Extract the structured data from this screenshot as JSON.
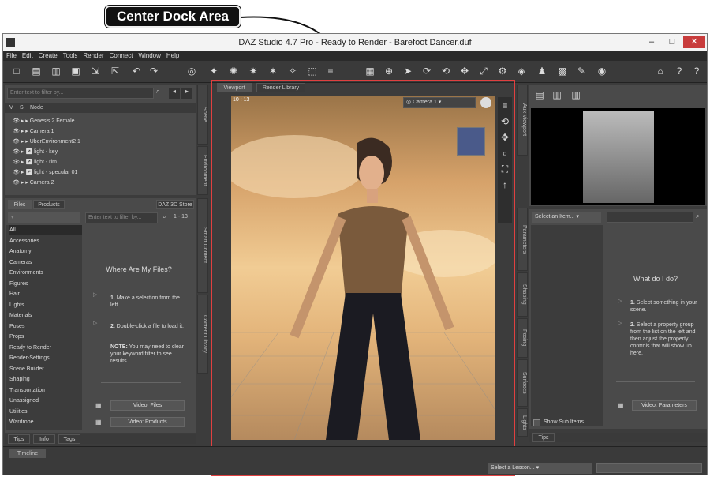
{
  "callout": {
    "label": "Center Dock Area"
  },
  "window": {
    "title": "DAZ Studio 4.7 Pro - Ready to Render - Barefoot Dancer.duf"
  },
  "menu": [
    "File",
    "Edit",
    "Create",
    "Tools",
    "Render",
    "Connect",
    "Window",
    "Help"
  ],
  "scene": {
    "filter_placeholder": "Enter text to filter by...",
    "col_v": "V",
    "col_s": "S",
    "col_node": "Node",
    "nodes": [
      "Genesis 2 Female",
      "Camera 1",
      "UberEnvironment2 1",
      "light - key",
      "light - rim",
      "light - specular 01",
      "Camera 2"
    ],
    "side_tabs": [
      "Scene",
      "Environment"
    ]
  },
  "content": {
    "tabs": [
      "Files",
      "Products"
    ],
    "store_label": "DAZ 3D Store",
    "filter_placeholder": "Enter text to filter by...",
    "count": "1 - 13",
    "categories": [
      "All",
      "Accessories",
      "Anatomy",
      "Cameras",
      "Environments",
      "Figures",
      "Hair",
      "Lights",
      "Materials",
      "Poses",
      "Props",
      "Ready to Render",
      "Render-Settings",
      "Scene Builder",
      "Shaping",
      "Transportation",
      "Unassigned",
      "Utilities",
      "Wardrobe"
    ],
    "help_title": "Where Are My Files?",
    "step1": "Make a selection from the left.",
    "step2": "Double-click a file to load it.",
    "note": "You may need to clear your keyword filter to see results.",
    "note_label": "NOTE:",
    "video1": "Video: Files",
    "video2": "Video: Products",
    "side_tabs": [
      "Smart Content",
      "Content Library"
    ]
  },
  "bottom_tabs": [
    "Tips",
    "Info",
    "Tags"
  ],
  "viewport": {
    "tabs": [
      "Viewport",
      "Render Library"
    ],
    "camera": "Camera 1",
    "corner_text": "10 : 13"
  },
  "right": {
    "aux_tab": "Aux Viewport",
    "select_item": "Select an Item...",
    "help_title": "What do I do?",
    "step1": "Select something in your scene.",
    "step2": "Select a property group from the list on the left and then adjust the property controls that will show up here.",
    "video": "Video: Parameters",
    "show_sub": "Show Sub Items",
    "tips_tab": "Tips",
    "side_tabs": [
      "Parameters",
      "Shaping",
      "Posing",
      "Surfaces",
      "Lights"
    ]
  },
  "timeline": {
    "label": "Timeline",
    "lesson": "Select a Lesson..."
  }
}
